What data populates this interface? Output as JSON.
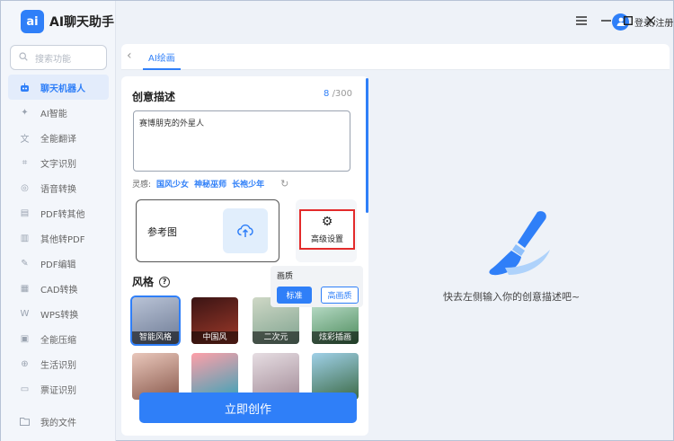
{
  "app": {
    "logo_mark": "ai",
    "name": "AI聊天助手"
  },
  "search": {
    "placeholder": "搜索功能"
  },
  "sidebar": {
    "items": [
      {
        "label": "聊天机器人",
        "icon": "robot-icon",
        "active": true
      },
      {
        "label": "AI智能",
        "icon": "ai-icon"
      },
      {
        "label": "全能翻译",
        "icon": "translate-icon"
      },
      {
        "label": "文字识别",
        "icon": "scan-icon"
      },
      {
        "label": "语音转换",
        "icon": "voice-icon"
      },
      {
        "label": "PDF转其他",
        "icon": "pdf-icon"
      },
      {
        "label": "其他转PDF",
        "icon": "file-icon"
      },
      {
        "label": "PDF编辑",
        "icon": "edit-icon"
      },
      {
        "label": "CAD转换",
        "icon": "cad-icon"
      },
      {
        "label": "WPS转换",
        "icon": "wps-icon"
      },
      {
        "label": "全能压缩",
        "icon": "compress-icon"
      },
      {
        "label": "生活识别",
        "icon": "life-icon"
      },
      {
        "label": "票证识别",
        "icon": "ticket-icon"
      }
    ],
    "bottom": {
      "label": "我的文件",
      "icon": "folder-icon"
    }
  },
  "header": {
    "login": "登录/注册"
  },
  "tabs": {
    "active": "AI绘画"
  },
  "form": {
    "title": "创意描述",
    "count_current": "8",
    "count_max": "/300",
    "prompt_value": "赛博朋克的外星人",
    "inspire_label": "灵感:",
    "inspire_tags": [
      "国风少女",
      "神秘巫师",
      "长袍少年"
    ],
    "ref_label": "参考图",
    "advanced_label": "高级设置",
    "style_title": "风格",
    "styles": [
      "智能风格",
      "中国风",
      "二次元",
      "炫彩插画",
      "",
      "",
      "",
      ""
    ],
    "create_button": "立即创作"
  },
  "quality": {
    "title": "画质",
    "standard": "标准",
    "high": "高画质"
  },
  "preview": {
    "placeholder": "快去左侧输入你的创意描述吧~"
  },
  "colors": {
    "accent": "#2f7ff8",
    "highlight_border": "#e32b2b"
  }
}
